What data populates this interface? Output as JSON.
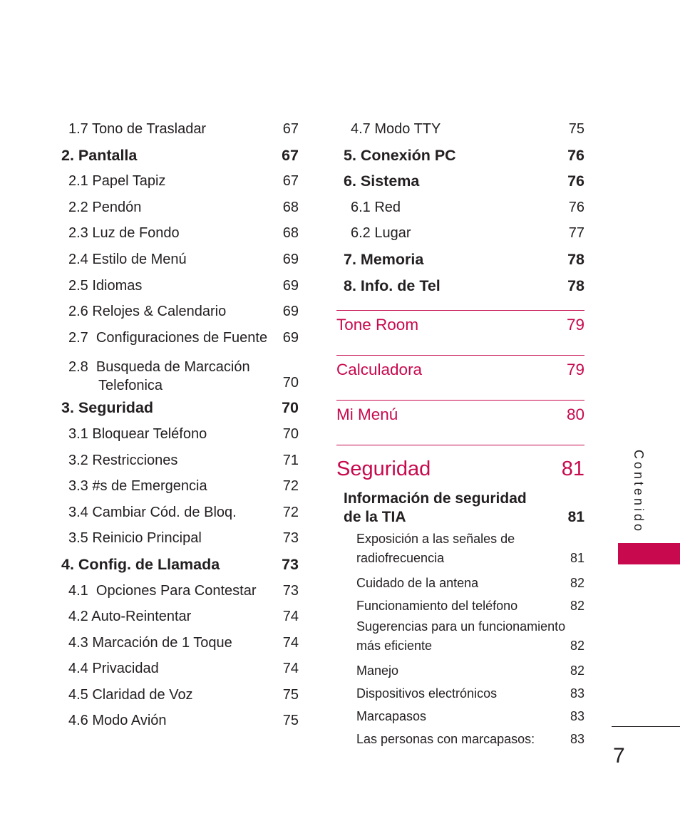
{
  "left_column": [
    {
      "level": "sub",
      "label": "1.7 Tono de Trasladar",
      "page": "67"
    },
    {
      "level": "main",
      "label": "2. Pantalla",
      "page": "67"
    },
    {
      "level": "sub",
      "label": "2.1 Papel Tapiz",
      "page": "67"
    },
    {
      "level": "sub",
      "label": "2.2 Pendón",
      "page": "68"
    },
    {
      "level": "sub",
      "label": "2.3 Luz de Fondo",
      "page": "68"
    },
    {
      "level": "sub",
      "label": "2.4 Estilo de Menú",
      "page": "69"
    },
    {
      "level": "sub",
      "label": "2.5 Idiomas",
      "page": "69"
    },
    {
      "level": "sub",
      "label": "2.6 Relojes & Calendario",
      "page": "69"
    },
    {
      "level": "sub",
      "label": "2.7  Configuraciones de Fuente",
      "page": "69"
    },
    {
      "level": "sub",
      "label": "2.8  Busqueda de Marcación",
      "label2": "Telefonica",
      "page": "70"
    },
    {
      "level": "main",
      "label": "3. Seguridad",
      "page": "70"
    },
    {
      "level": "sub",
      "label": "3.1 Bloquear Teléfono",
      "page": "70"
    },
    {
      "level": "sub",
      "label": "3.2 Restricciones",
      "page": "71"
    },
    {
      "level": "sub",
      "label": "3.3 #s de Emergencia",
      "page": "72"
    },
    {
      "level": "sub",
      "label": "3.4 Cambiar Cód. de Bloq.",
      "page": "72"
    },
    {
      "level": "sub",
      "label": "3.5 Reinicio Principal",
      "page": "73"
    },
    {
      "level": "main",
      "label": "4. Config. de Llamada",
      "page": "73"
    },
    {
      "level": "sub",
      "label": "4.1  Opciones Para Contestar",
      "page": "73"
    },
    {
      "level": "sub",
      "label": "4.2 Auto-Reintentar",
      "page": "74"
    },
    {
      "level": "sub",
      "label": "4.3 Marcación de 1 Toque",
      "page": "74"
    },
    {
      "level": "sub",
      "label": "4.4 Privacidad",
      "page": "74"
    },
    {
      "level": "sub",
      "label": "4.5 Claridad de Voz",
      "page": "75"
    },
    {
      "level": "sub",
      "label": "4.6 Modo Avión",
      "page": "75"
    }
  ],
  "right_column": {
    "items": [
      {
        "level": "sub",
        "label": "4.7 Modo TTY",
        "page": "75"
      },
      {
        "level": "main",
        "label": "5. Conexión PC",
        "page": "76"
      },
      {
        "level": "main",
        "label": "6. Sistema",
        "page": "76"
      },
      {
        "level": "sub",
        "label": "6.1 Red",
        "page": "76"
      },
      {
        "level": "sub",
        "label": "6.2 Lugar",
        "page": "77"
      },
      {
        "level": "main",
        "label": "7. Memoria",
        "page": "78"
      },
      {
        "level": "main",
        "label": "8. Info. de Tel",
        "page": "78"
      }
    ],
    "sections": [
      {
        "label": "Tone Room",
        "page": "79"
      },
      {
        "label": "Calculadora",
        "page": "79"
      },
      {
        "label": "Mi Menú",
        "page": "80"
      }
    ],
    "safety_section": {
      "label": "Seguridad",
      "page": "81"
    },
    "tia": {
      "heading_line1": "Información de seguridad",
      "heading_line2": "de la TIA",
      "page": "81",
      "items": [
        {
          "label": "Exposición a las señales de",
          "label2": "radiofrecuencia",
          "page": "81"
        },
        {
          "label": "Cuidado de la antena",
          "page": "82"
        },
        {
          "label": "Funcionamiento del teléfono",
          "page": "82"
        },
        {
          "label": "Sugerencias para un funcionamiento",
          "label2": "más eficiente",
          "page": "82"
        },
        {
          "label": "Manejo",
          "page": "82"
        },
        {
          "label": "Dispositivos electrónicos",
          "page": "83"
        },
        {
          "label": "Marcapasos",
          "page": "83"
        },
        {
          "label": "Las personas con marcapasos:",
          "page": "83"
        }
      ]
    }
  },
  "side_tab": {
    "label": "Contenido",
    "color": "#c8094e"
  },
  "page_number": "7",
  "accent_color": "#c8094e"
}
